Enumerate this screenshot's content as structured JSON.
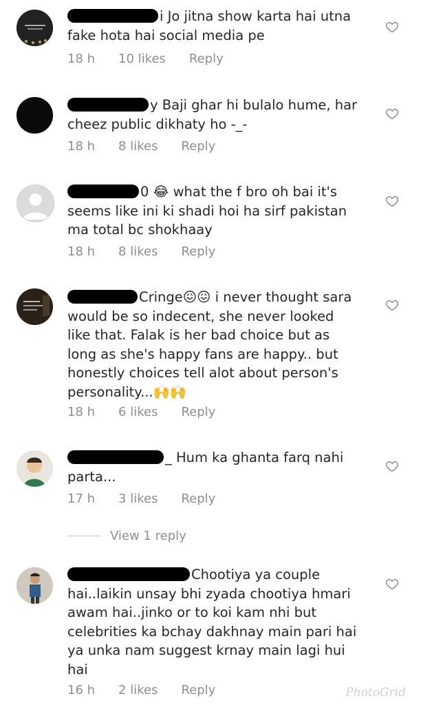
{
  "comments": [
    {
      "text": "i Jo jitna show karta hai utna\nfake hota hai social media pe",
      "time": "18 h",
      "likes": "10 likes",
      "reply": "Reply",
      "avatar_icon": "dark-photo-avatar"
    },
    {
      "text": "y Baji ghar hi bulalo hume,  har\ncheez public dikhaty ho -_-",
      "time": "18 h",
      "likes": "8 likes",
      "reply": "Reply",
      "avatar_icon": "black-avatar"
    },
    {
      "text": "0 😂 what the f bro oh bai it's\nseems like ini ki shadi hoi ha sirf pakistan\nma total bc shokhaay",
      "time": "18 h",
      "likes": "8 likes",
      "reply": "Reply",
      "avatar_icon": "default-user-avatar"
    },
    {
      "text": "Cringe😖😖 i never thought sara\nwould be so indecent, she never looked\nlike that. Falak is her bad choice but as\nlong as she's happy fans are happy.. but\nhonestly choices tell alot about person's\npersonality...🙌🙌",
      "time": "18 h",
      "likes": "6 likes",
      "reply": "Reply",
      "avatar_icon": "quote-image-avatar"
    },
    {
      "text": "_ Hum ka ghanta farq nahi\nparta...",
      "time": "17 h",
      "likes": "3 likes",
      "reply": "Reply",
      "avatar_icon": "child-photo-avatar"
    },
    {
      "text": "Chootiya ya couple\nhai..laikin unsay bhi zyada chootiya hmari\nawam hai..jinko or to koi kam nhi but\ncelebrities ka bchay dakhnay main pari hai\nya unka nam suggest krnay main lagi hui\nhai",
      "time": "16 h",
      "likes": "2 likes",
      "reply": "Reply",
      "avatar_icon": "man-photo-avatar"
    }
  ],
  "view_reply": "View 1 reply",
  "watermark": "PhotoGrid",
  "colors": {
    "text": "#262626",
    "meta": "#8e8e8e",
    "background": "#ffffff"
  }
}
